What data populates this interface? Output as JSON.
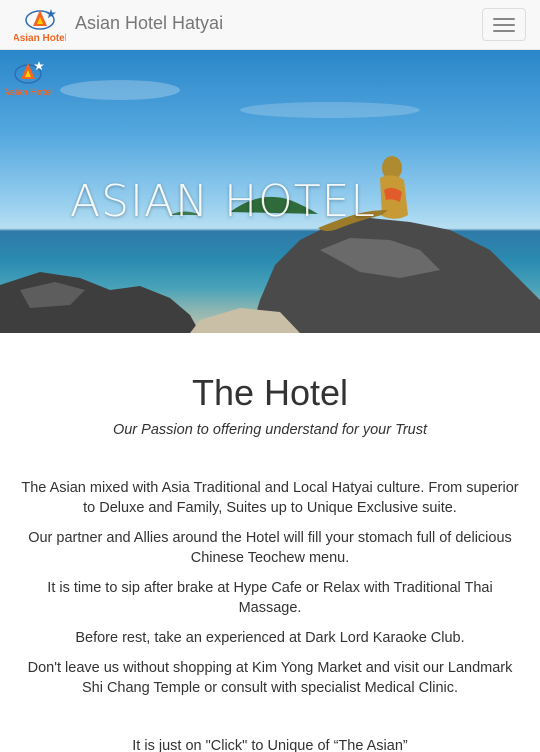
{
  "navbar": {
    "brand_name": "Asian Hotel Hatyai",
    "logo_text": "Asian Hotel",
    "logo_icon": "star-pyramid-logo",
    "menu_icon": "hamburger-menu-icon"
  },
  "hero": {
    "title": "ASIAN HOTEL",
    "logo_text": "Asian Hotel",
    "scene": "mermaid-statue-on-rocks-by-sea"
  },
  "main": {
    "heading": "The Hotel",
    "subtitle": "Our Passion to offering understand for your Trust",
    "paragraphs": [
      "The Asian mixed with Asia Traditional and Local Hatyai culture. From superior to Deluxe and Family, Suites up to Unique Exclusive suite.",
      "Our partner and Allies around the Hotel will fill your stomach full of delicious Chinese  Teochew menu.",
      "It is time to sip after brake at Hype Cafe or Relax with Traditional Thai Massage.",
      "Before rest, take an experienced at Dark Lord Karaoke Club.",
      "Don't leave us without shopping at Kim Yong Market and visit our Landmark Shi Chang  Temple or consult with specialist Medical Clinic."
    ],
    "closing": "It is just on \"Click\" to Unique of “The Asian”"
  },
  "colors": {
    "navbar_bg": "#f8f8f8",
    "brand_text": "#777777",
    "logo_orange": "#f26522",
    "logo_blue": "#2e6db4",
    "body_text": "#333333"
  }
}
